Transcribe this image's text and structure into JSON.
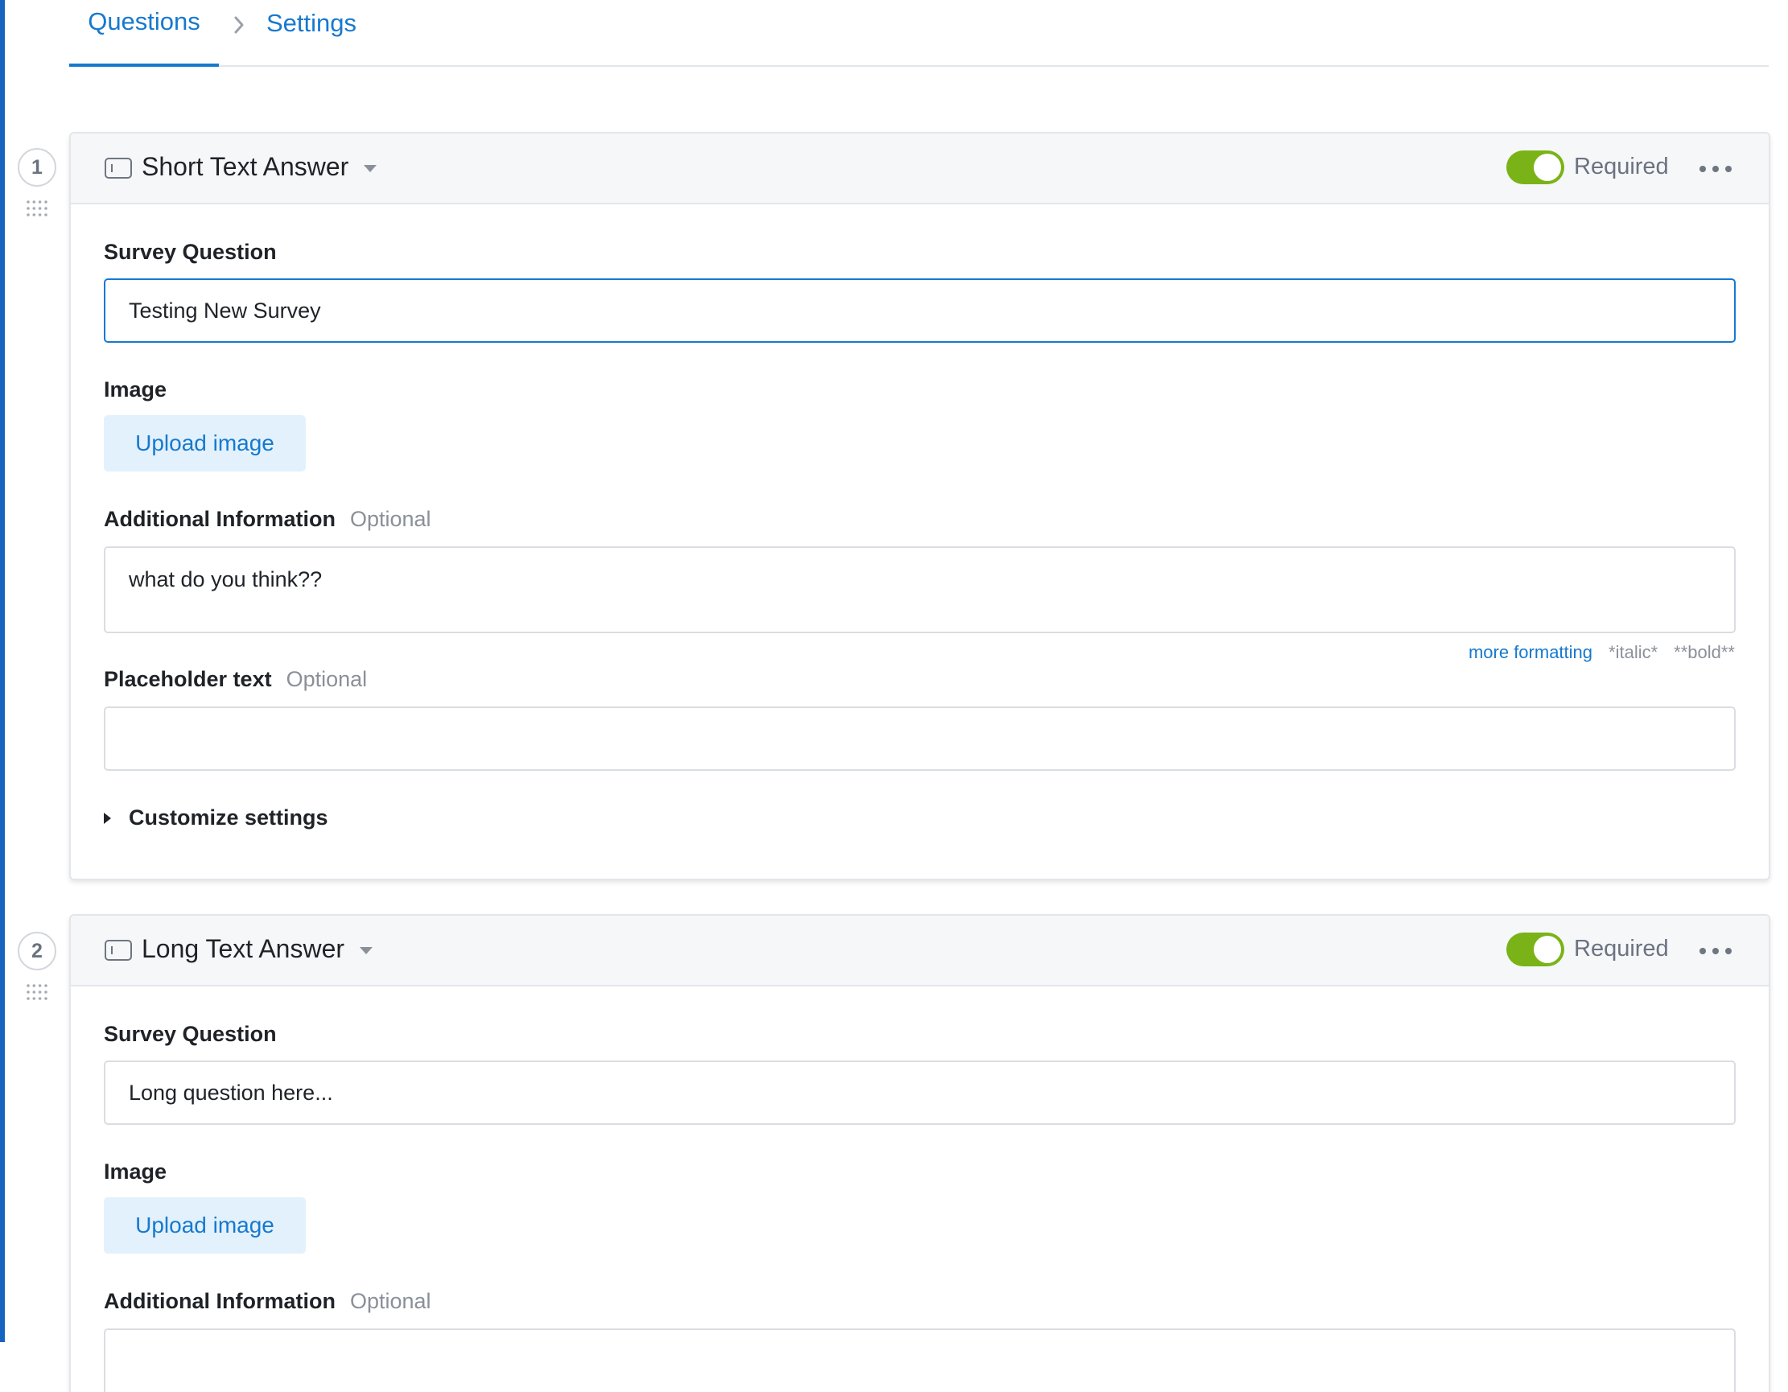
{
  "tabs": {
    "questions_label": "Questions",
    "settings_label": "Settings"
  },
  "questions": [
    {
      "number": "1",
      "type_label": "Short Text Answer",
      "required_label": "Required",
      "required": true,
      "survey_question_label": "Survey Question",
      "survey_question_value": "Testing New Survey",
      "image_label": "Image",
      "upload_label": "Upload image",
      "additional_info_label": "Additional Information",
      "optional_label": "Optional",
      "additional_info_value": "what do you think??",
      "more_formatting_label": "more formatting",
      "italic_hint": "*italic*",
      "bold_hint": "**bold**",
      "placeholder_label": "Placeholder text",
      "placeholder_value": "",
      "customize_label": "Customize settings"
    },
    {
      "number": "2",
      "type_label": "Long Text Answer",
      "required_label": "Required",
      "required": true,
      "survey_question_label": "Survey Question",
      "survey_question_value": "Long question here...",
      "image_label": "Image",
      "upload_label": "Upload image",
      "additional_info_label": "Additional Information",
      "optional_label": "Optional",
      "additional_info_value": ""
    }
  ],
  "colors": {
    "accent": "#1679cf",
    "toggle_on": "#7ab317",
    "nav_bar": "#1664c0"
  }
}
